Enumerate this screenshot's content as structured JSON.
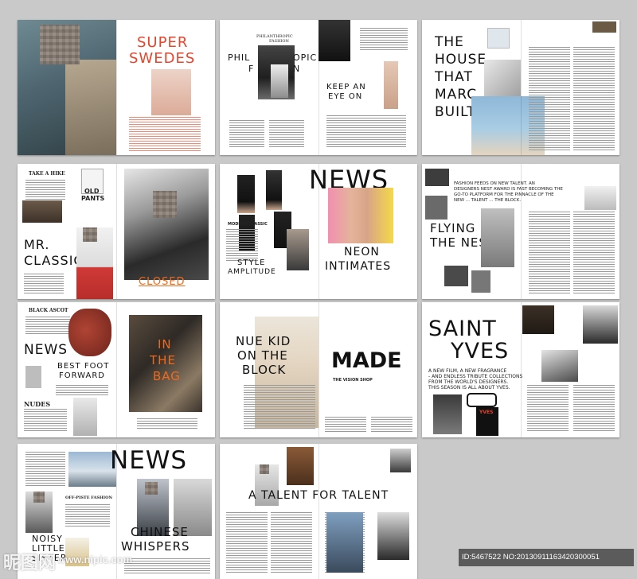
{
  "spreads": {
    "s1": {
      "title_line1": "SUPER",
      "title_line2": "SWEDES"
    },
    "s2": {
      "kicker_line1": "PHILANTHROPIC",
      "kicker_line2": "FASHION",
      "title_line1": "PHIL",
      "title_line2": "OPIC",
      "title_line3": "F",
      "title_line4": "N",
      "side_line1": "KEEP AN",
      "side_line2": "EYE ON"
    },
    "s3": {
      "title_line1": "THE",
      "title_line2": "HOUSE",
      "title_line3": "THAT",
      "title_line4": "MARC",
      "title_line5": "BUILT"
    },
    "s4": {
      "kicker": "TAKE A HIKE",
      "tag_line1": "OLD",
      "tag_line2": "PANTS",
      "title_line1": "MR.",
      "title_line2": "CLASSIC",
      "closed": "CLOSED"
    },
    "s5": {
      "title": "NEWS",
      "kicker": "MODERN CLASSIC",
      "tag_line1": "STYLE",
      "tag_line2": "AMPLITUDE",
      "sub_line1": "NEON",
      "sub_line2": "INTIMATES"
    },
    "s6": {
      "intro_line1": "FASHION FEEDS ON NEW TALENT. AN",
      "intro_line2": "DESIGNERS NEST AWARD IS FAST BECOMING THE",
      "intro_line3": "GO-TO PLATFORM FOR THE PINNACLE OF THE",
      "intro_line4": "NEW ... TALENT ... THE BLOCK.",
      "title_line1": "FLYING",
      "title_line2": "THE NEST"
    },
    "s7": {
      "kicker": "BLACK ASCOT",
      "title": "NEWS",
      "sub_line1": "BEST FOOT",
      "sub_line2": "FORWARD",
      "side": "NUDES",
      "overlay_line1": "IN",
      "overlay_line2": "THE",
      "overlay_line3": "BAG"
    },
    "s8": {
      "title_line1": "NUE KID",
      "title_line2": "ON THE",
      "title_line3": "BLOCK",
      "right_title": "MADE",
      "right_kicker": "THE VISION SHOP"
    },
    "s9": {
      "title_line1": "SAINT",
      "title_line2": "YVES",
      "intro_line1": "A NEW FILM, A NEW FRAGRANCE",
      "intro_line2": "- AND ENDLESS TRIBUTE COLLECTIONS",
      "intro_line3": "FROM THE WORLD'S DESIGNERS.",
      "intro_line4": "THIS SEASON IS ALL ABOUT YVES.",
      "label": "YVES"
    },
    "s10": {
      "title": "NEWS",
      "kicker": "OFF-PISTE FASHION",
      "left_line1": "NOISY",
      "left_line2": "LITTLE",
      "left_line3": "SISTER",
      "sub_line1": "CHINESE",
      "sub_line2": "WHISPERS"
    },
    "s11": {
      "title": "A TALENT FOR TALENT"
    }
  },
  "watermark": {
    "logo": "昵图网",
    "url": "www.nipic.com",
    "id_text": "ID:5467522 NO:20130911163420300051"
  },
  "colors": {
    "background": "#c9c9c9",
    "red": "#e8432b",
    "orange": "#ef6a1c",
    "black": "#111111"
  }
}
